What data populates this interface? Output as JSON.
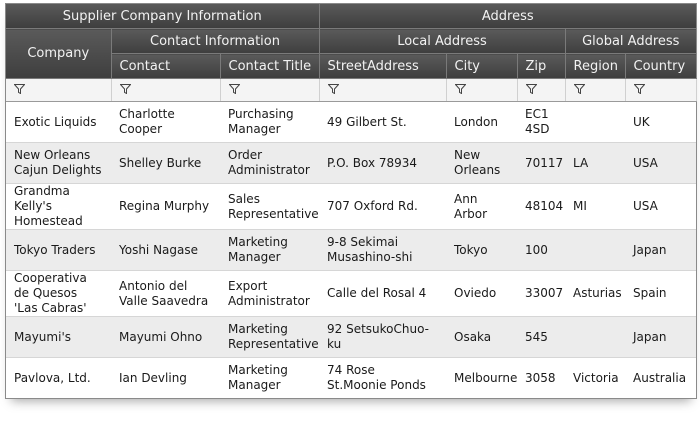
{
  "header": {
    "group_supplier": "Supplier Company Information",
    "group_address": "Address",
    "company": "Company",
    "group_contact_info": "Contact Information",
    "group_local_address": "Local Address",
    "group_global_address": "Global Address",
    "columns": [
      "Contact",
      "Contact Title",
      "StreetAddress",
      "City",
      "Zip",
      "Region",
      "Country"
    ]
  },
  "rows": [
    {
      "company": "Exotic Liquids",
      "contact": "Charlotte Cooper",
      "title": "Purchasing Manager",
      "street": "49 Gilbert St.",
      "city": "London",
      "zip": "EC1 4SD",
      "region": "",
      "country": "UK"
    },
    {
      "company": "New Orleans Cajun Delights",
      "contact": "Shelley Burke",
      "title": "Order Administrator",
      "street": "P.O. Box 78934",
      "city": "New Orleans",
      "zip": "70117",
      "region": "LA",
      "country": "USA"
    },
    {
      "company": "Grandma Kelly's Homestead",
      "contact": "Regina Murphy",
      "title": "Sales Representative",
      "street": "707 Oxford Rd.",
      "city": "Ann Arbor",
      "zip": "48104",
      "region": "MI",
      "country": "USA"
    },
    {
      "company": "Tokyo Traders",
      "contact": "Yoshi Nagase",
      "title": "Marketing Manager",
      "street": "9-8 Sekimai Musashino-shi",
      "city": "Tokyo",
      "zip": "100",
      "region": "",
      "country": "Japan"
    },
    {
      "company": "Cooperativa de Quesos 'Las Cabras'",
      "contact": "Antonio del Valle Saavedra",
      "title": "Export Administrator",
      "street": "Calle del Rosal 4",
      "city": "Oviedo",
      "zip": "33007",
      "region": "Asturias",
      "country": "Spain"
    },
    {
      "company": "Mayumi's",
      "contact": "Mayumi Ohno",
      "title": "Marketing Representative",
      "street": "92 SetsukoChuo-ku",
      "city": "Osaka",
      "zip": "545",
      "region": "",
      "country": "Japan"
    },
    {
      "company": "Pavlova, Ltd.",
      "contact": "Ian Devling",
      "title": "Marketing Manager",
      "street": "74 Rose St.Moonie Ponds",
      "city": "Melbourne",
      "zip": "3058",
      "region": "Victoria",
      "country": "Australia"
    }
  ],
  "icons": {
    "filter": "filter-funnel-icon"
  }
}
